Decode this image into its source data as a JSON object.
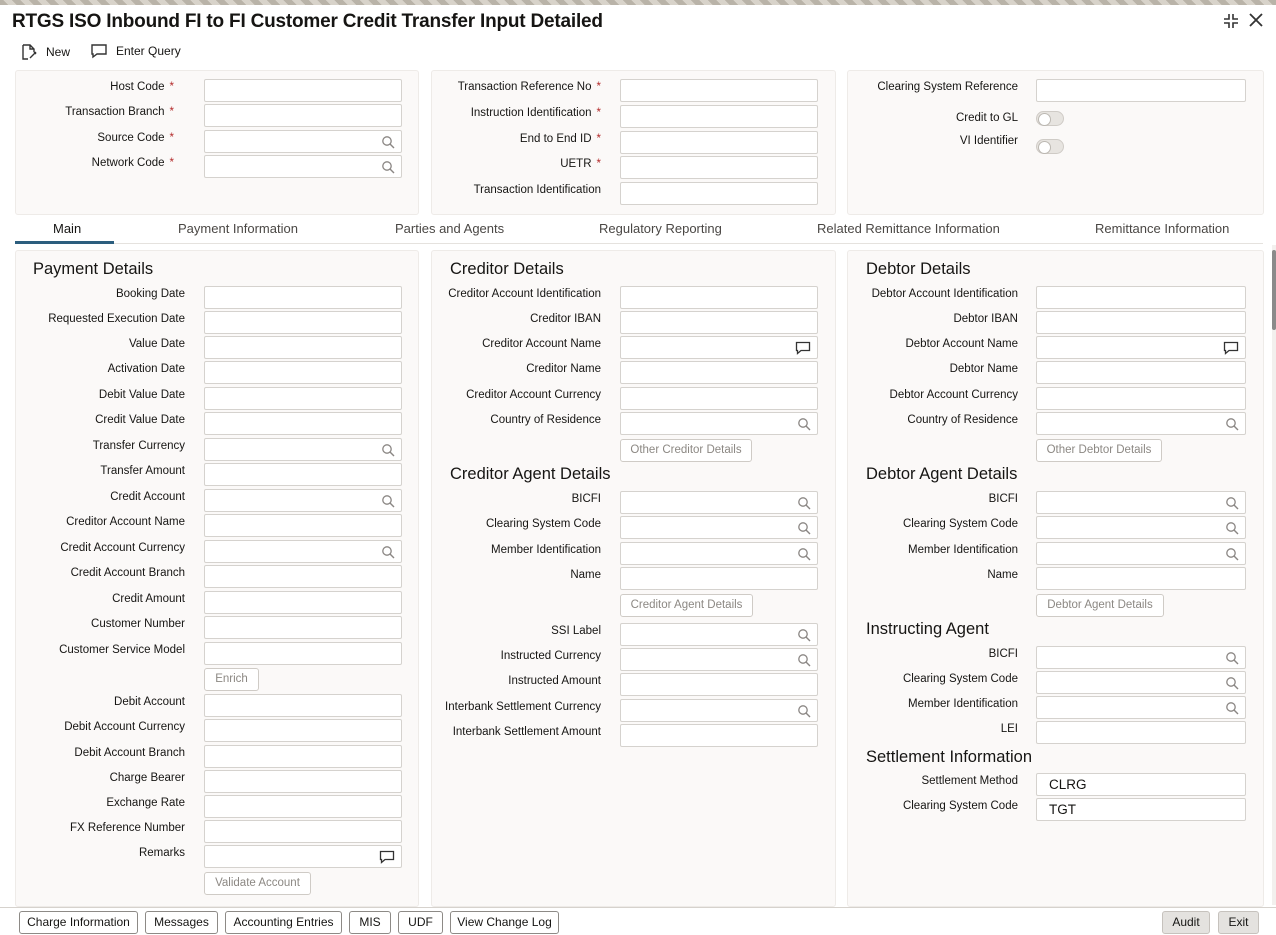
{
  "title": "RTGS ISO Inbound FI to FI Customer Credit Transfer Input Detailed",
  "toolbar": {
    "new_label": "New",
    "enter_query_label": "Enter Query"
  },
  "header": {
    "host_code": "Host Code",
    "transaction_branch": "Transaction Branch",
    "source_code": "Source Code",
    "network_code": "Network Code",
    "transaction_reference_no": "Transaction Reference No",
    "instruction_identification": "Instruction Identification",
    "end_to_end_id": "End to End ID",
    "uetr": "UETR",
    "transaction_identification": "Transaction Identification",
    "clearing_system_reference": "Clearing System Reference",
    "credit_to_gl": "Credit to GL",
    "vi_identifier": "VI Identifier",
    "required_mark": "*"
  },
  "tabs": [
    "Main",
    "Payment Information",
    "Parties and Agents",
    "Regulatory Reporting",
    "Related Remittance Information",
    "Remittance Information"
  ],
  "payment": {
    "title": "Payment Details",
    "labels": [
      "Booking Date",
      "Requested Execution Date",
      "Value Date",
      "Activation Date",
      "Debit Value Date",
      "Credit Value Date",
      "Transfer Currency",
      "Transfer Amount",
      "Credit Account",
      "Creditor Account Name",
      "Credit Account Currency",
      "Credit Account Branch",
      "Credit Amount",
      "Customer Number",
      "Customer Service Model"
    ],
    "enrich": "Enrich",
    "labels2": [
      "Debit Account",
      "Debit Account Currency",
      "Debit Account Branch",
      "Charge Bearer",
      "Exchange Rate",
      "FX Reference Number",
      "Remarks"
    ],
    "validate_account": "Validate Account"
  },
  "creditor": {
    "title": "Creditor Details",
    "labels": [
      "Creditor Account Identification",
      "Creditor IBAN",
      "Creditor Account Name",
      "Creditor Name",
      "Creditor Account Currency",
      "Country of Residence"
    ],
    "other_button": "Other Creditor Details",
    "agent_title": "Creditor Agent Details",
    "agent_labels": [
      "BICFI",
      "Clearing System Code",
      "Member Identification",
      "Name"
    ],
    "agent_button": "Creditor Agent Details",
    "extra_labels": [
      "SSI Label",
      "Instructed Currency",
      "Instructed Amount",
      "Interbank Settlement Currency",
      "Interbank Settlement Amount"
    ]
  },
  "debtor": {
    "title": "Debtor Details",
    "labels": [
      "Debtor Account Identification",
      "Debtor IBAN",
      "Debtor Account Name",
      "Debtor Name",
      "Debtor Account Currency",
      "Country of Residence"
    ],
    "other_button": "Other Debtor Details",
    "agent_title": "Debtor Agent Details",
    "agent_labels": [
      "BICFI",
      "Clearing System Code",
      "Member Identification",
      "Name"
    ],
    "agent_button": "Debtor Agent Details",
    "instructing_title": "Instructing Agent",
    "instructing_labels": [
      "BICFI",
      "Clearing System Code",
      "Member Identification",
      "LEI"
    ],
    "settlement_title": "Settlement Information",
    "settlement_method_label": "Settlement Method",
    "settlement_method_value": "CLRG",
    "clearing_system_code_label": "Clearing System Code",
    "clearing_system_code_value": "TGT"
  },
  "footer": {
    "buttons": [
      "Charge Information",
      "Messages",
      "Accounting Entries",
      "MIS",
      "UDF",
      "View Change Log"
    ],
    "audit": "Audit",
    "exit": "Exit"
  },
  "icons": {
    "search": "search-icon",
    "comment": "comment-icon",
    "new": "new-document-icon",
    "enter_query": "chat-query-icon",
    "collapse": "collapse-icon",
    "close": "close-icon"
  },
  "colors": {
    "accent": "#2c5e7e",
    "required": "#b32a2a"
  }
}
